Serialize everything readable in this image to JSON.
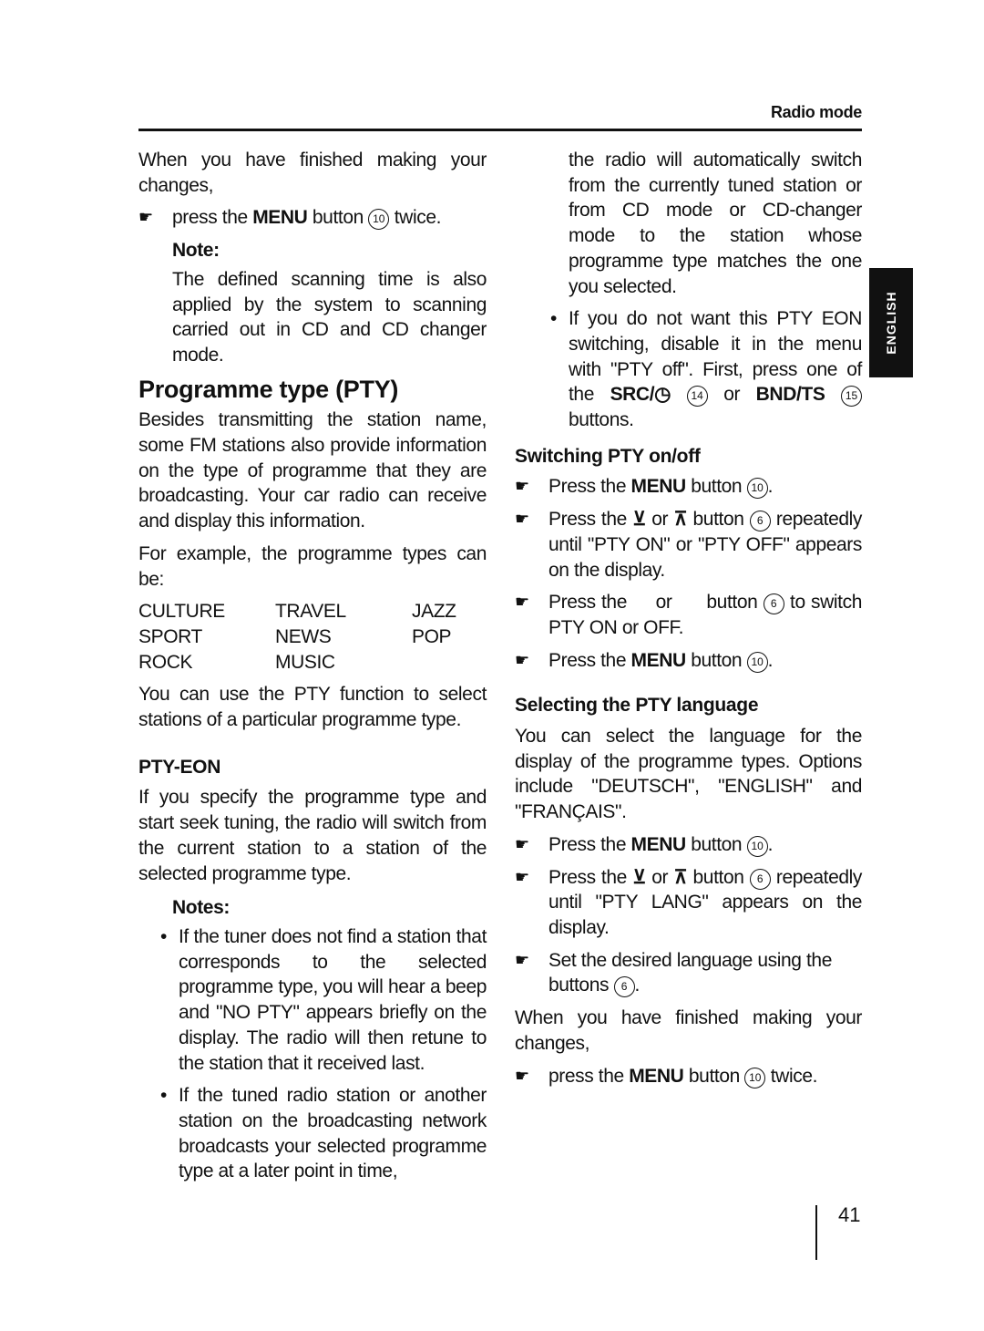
{
  "header": {
    "title": "Radio mode"
  },
  "side_tab": {
    "label": "ENGLISH"
  },
  "page_number": "41",
  "left_column": {
    "intro": "When you have finished making your changes,",
    "press_menu_twice": {
      "pre": "press the ",
      "bold": "MENU",
      "mid": " button ",
      "num": "10",
      "post": " twice."
    },
    "note_heading": "Note:",
    "note_text": "The defined scanning time is also applied by the system to scanning carried out in CD and CD changer mode.",
    "section_title": "Programme type (PTY)",
    "section_intro": "Besides transmitting the station name, some FM stations also provide information on the type of programme that they are broadcasting. Your car radio can receive and display this information.",
    "example_lead": "For example, the programme types can be:",
    "programme_types": [
      "CULTURE",
      "TRAVEL",
      "JAZZ",
      "SPORT",
      "NEWS",
      "POP",
      "ROCK",
      "MUSIC",
      ""
    ],
    "pty_function_text": "You can use the PTY function to select stations of a particular programme type.",
    "pty_eon_heading": "PTY-EON",
    "pty_eon_text": "If you specify the programme type and start seek tuning, the radio will switch from the current station to a station of the selected programme type.",
    "notes_heading": "Notes:",
    "notes": [
      "If the tuner does not find a station that corresponds to the selected programme type, you will hear a beep and \"NO PTY\" appears briefly on the display. The radio will then retune to the station that it received last.",
      "If the tuned radio station or another station on the broadcasting network broadcasts your selected programme type at a later point in time,"
    ]
  },
  "right_column": {
    "continuation": "the radio will automatically switch from the currently tuned station or from CD mode or CD-changer mode to the station whose programme type matches the one you selected.",
    "eon_off_note": {
      "text": "If you do not want this PTY EON switching, disable it in the menu with \"PTY off\". First, press one of the ",
      "src": "SRC/",
      "src_num": "14",
      "or": " or ",
      "bnd": "BND/TS",
      "bnd_num": "15",
      "post": " buttons."
    },
    "switching_heading": "Switching PTY on/off",
    "switching_steps": {
      "s1": {
        "pre": "Press the ",
        "bold": "MENU",
        "mid": " button ",
        "num": "10",
        "post": "."
      },
      "s2": {
        "pre": "Press the ",
        "down": "⊻",
        "or": " or ",
        "up": "⊼",
        "mid": " button ",
        "num": "6",
        "post": " repeatedly until \"PTY ON\" or \"PTY OFF\" appears on the display."
      },
      "s3": {
        "pre": "Press the ",
        "or": " or ",
        "mid": " button ",
        "num": "6",
        "post": " to switch PTY ON or OFF."
      },
      "s4": {
        "pre": "Press the ",
        "bold": "MENU",
        "mid": " button ",
        "num": "10",
        "post": "."
      }
    },
    "language_heading": "Selecting the PTY language",
    "language_intro": "You can select the language for the display of the programme types. Options include \"DEUTSCH\", \"ENGLISH\" and \"FRANÇAIS\".",
    "language_steps": {
      "s1": {
        "pre": "Press the ",
        "bold": "MENU",
        "mid": " button ",
        "num": "10",
        "post": "."
      },
      "s2": {
        "pre": "Press the ",
        "down": "⊻",
        "or": " or ",
        "up": "⊼",
        "mid": " button ",
        "num": "6",
        "post": " repeatedly until \"PTY LANG\" appears on the display."
      },
      "s3": {
        "pre": "Set the desired language using the buttons ",
        "num": "6",
        "post": "."
      }
    },
    "finish_text": "When you have finished making your changes,",
    "finish_step": {
      "pre": "press the ",
      "bold": "MENU",
      "mid": " button ",
      "num": "10",
      "post": " twice."
    }
  }
}
